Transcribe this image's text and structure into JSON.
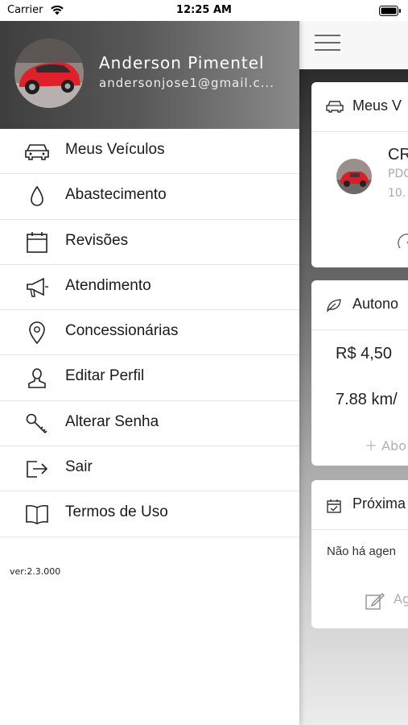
{
  "status_bar": {
    "carrier": "Carrier",
    "time": "12:25 AM"
  },
  "drawer": {
    "user": {
      "name": "Anderson Pimentel",
      "email": "andersonjose1@gmail.c..."
    },
    "menu": [
      {
        "label": "Meus Veículos",
        "icon": "car-icon"
      },
      {
        "label": "Abastecimento",
        "icon": "drop-icon"
      },
      {
        "label": "Revisões",
        "icon": "calendar-icon"
      },
      {
        "label": "Atendimento",
        "icon": "megaphone-icon"
      },
      {
        "label": "Concessionárias",
        "icon": "location-pin-icon"
      },
      {
        "label": "Editar Perfil",
        "icon": "user-icon"
      },
      {
        "label": "Alterar Senha",
        "icon": "key-icon"
      },
      {
        "label": "Sair",
        "icon": "logout-icon"
      },
      {
        "label": "Termos de Uso",
        "icon": "book-icon"
      }
    ],
    "version": "ver:2.3.000"
  },
  "main": {
    "vehicles_card": {
      "title": "Meus V",
      "vehicle_name": "CR",
      "vehicle_plate": "PDC",
      "vehicle_km": "10."
    },
    "autonomy_card": {
      "title": "Autono",
      "price": "R$ 4,50",
      "consumption": "7.88 km/",
      "add_label": "Abo"
    },
    "next_card": {
      "title": "Próxima",
      "empty_text": "Não há agen",
      "schedule_label": "Ag"
    }
  },
  "colors": {
    "header_gradient_start": "#3e3e3e",
    "header_gradient_end": "#8a8a8a",
    "car_red": "#e0202a",
    "divider": "#e5e5e5"
  }
}
